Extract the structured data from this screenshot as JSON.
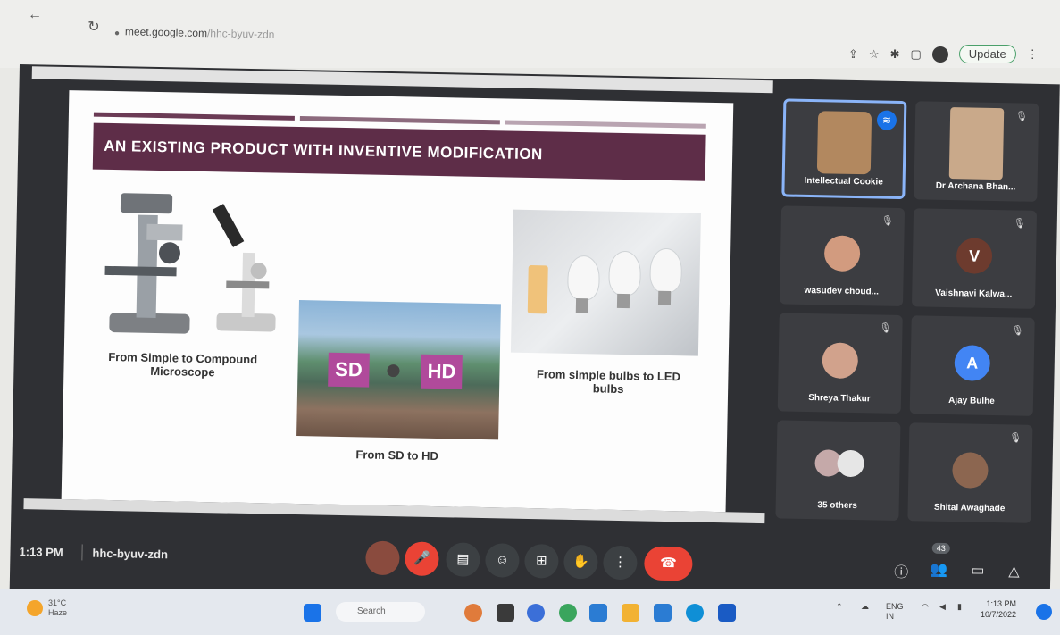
{
  "browser": {
    "back_icon": "arrow-left-icon",
    "reload_icon": "reload-icon",
    "url_host": "meet.google.com",
    "url_path": "/hhc-byuv-zdn",
    "update_label": "Update"
  },
  "slide": {
    "banner_title": "AN EXISTING PRODUCT WITH INVENTIVE MODIFICATION",
    "caption_microscope": "From Simple to Compound Microscope",
    "caption_sdhd": "From SD to HD",
    "caption_bulbs": "From simple bulbs to LED bulbs",
    "sd_label": "SD",
    "hd_label": "HD",
    "colors": {
      "banner": "#5e2d48",
      "sd_hd_box": "#b04a9b"
    }
  },
  "participants": [
    {
      "name": "Intellectual Cookie",
      "avatar": "",
      "avatar_color": "#b2885f",
      "speaking": true
    },
    {
      "name": "Dr Archana Bhan...",
      "avatar": "",
      "avatar_color": "#c9a98a",
      "speaking": false
    },
    {
      "name": "wasudev choud...",
      "avatar": "",
      "avatar_color": "#d29b7f",
      "speaking": false
    },
    {
      "name": "Vaishnavi Kalwa...",
      "avatar": "V",
      "avatar_color": "#6d3b2e",
      "speaking": false
    },
    {
      "name": "Shreya Thakur",
      "avatar": "",
      "avatar_color": "#d1a28c",
      "speaking": false
    },
    {
      "name": "Ajay Bulhe",
      "avatar": "A",
      "avatar_color": "#4285f4",
      "speaking": false
    },
    {
      "name": "35 others",
      "avatar": "",
      "avatar_color": "#c5a9a9",
      "speaking": false
    },
    {
      "name": "Shital Awaghade",
      "avatar": "",
      "avatar_color": "#8c6650",
      "speaking": false
    }
  ],
  "controls": {
    "time": "1:13 PM",
    "meeting_code": "hhc-byuv-zdn",
    "participant_count": "43"
  },
  "taskbar": {
    "temperature": "31°C",
    "weather": "Haze",
    "search_placeholder": "Search",
    "lang_primary": "ENG",
    "lang_secondary": "IN",
    "clock_time": "1:13 PM",
    "clock_date": "10/7/2022"
  }
}
